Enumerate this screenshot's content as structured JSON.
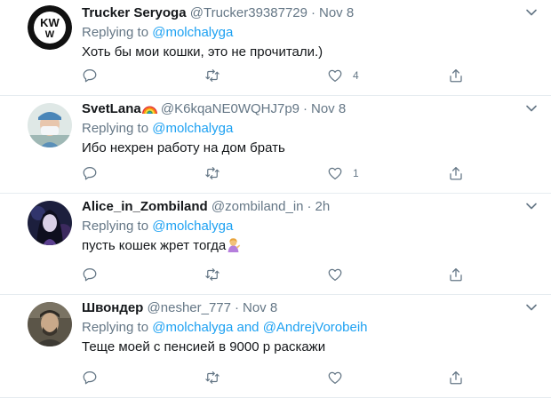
{
  "tweets": [
    {
      "name": "Trucker Seryoga",
      "handle": "@Trucker39387729",
      "dot": "·",
      "time": "Nov 8",
      "replying_prefix": "Replying to",
      "mentions": [
        "@molchalyga"
      ],
      "mention_joiner": "",
      "text": "Хоть бы мои кошки, это не прочитали.)",
      "like_count": "4",
      "avatar_text": "KW"
    },
    {
      "name": "SvetLana",
      "handle": "@K6kqaNE0WQHJ7p9",
      "dot": "·",
      "time": "Nov 8",
      "replying_prefix": "Replying to",
      "mentions": [
        "@molchalyga"
      ],
      "mention_joiner": "",
      "text": "Ибо нехрен работу на дом брать",
      "like_count": "1"
    },
    {
      "name": "Alice_in_Zombiland",
      "handle": "@zombiland_in",
      "dot": "·",
      "time": "2h",
      "replying_prefix": "Replying to",
      "mentions": [
        "@molchalyga"
      ],
      "mention_joiner": "",
      "text": "пусть кошек жрет тогда",
      "like_count": ""
    },
    {
      "name": "Швондер",
      "handle": "@nesher_777",
      "dot": "·",
      "time": "Nov 8",
      "replying_prefix": "Replying to",
      "mentions": [
        "@molchalyga",
        "@AndrejVorobeih"
      ],
      "mention_joiner": "and",
      "text": "Теще моей с пенсией в 9000 р раскажи",
      "like_count": ""
    }
  ],
  "icons": {
    "more": "chevron-down-icon",
    "reply": "reply-icon",
    "retweet": "retweet-icon",
    "like": "heart-icon",
    "share": "share-icon"
  },
  "colors": {
    "text": "#14171a",
    "secondary": "#657786",
    "link": "#1da1f2",
    "divider": "#e6ecf0"
  }
}
